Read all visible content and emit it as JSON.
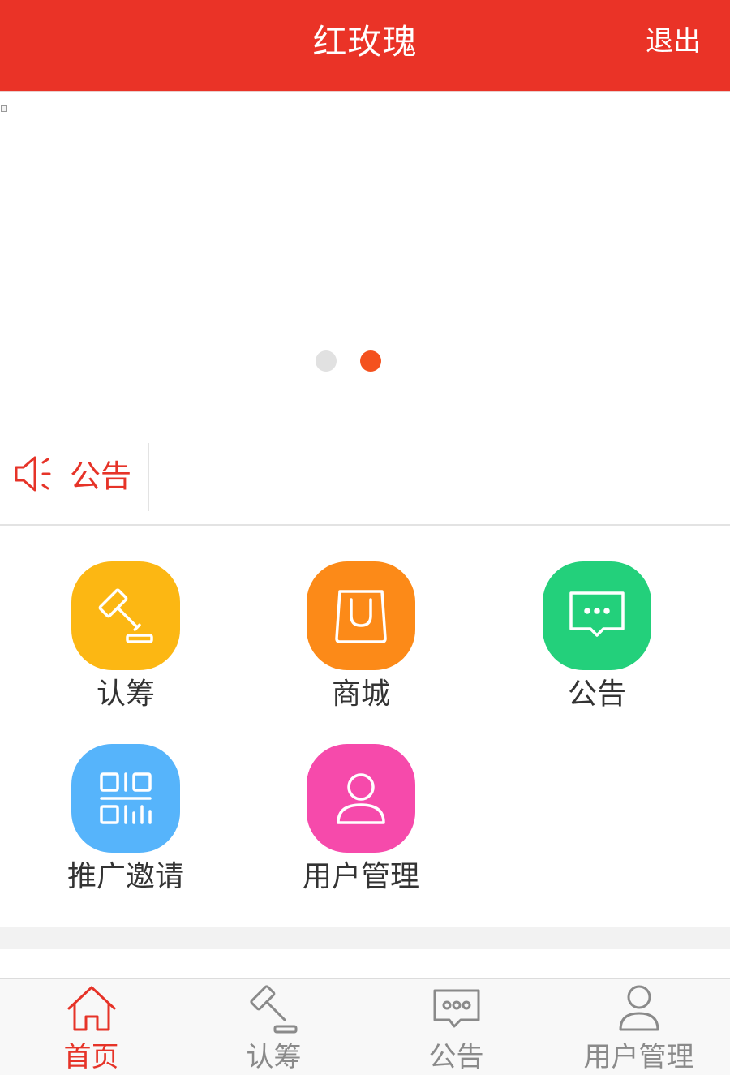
{
  "header": {
    "title": "红玫瑰",
    "logout_label": "退出"
  },
  "banner": {
    "active_slide": 2,
    "slide_count": 2
  },
  "notice": {
    "label": "公告",
    "icon": "speaker-icon"
  },
  "grid": {
    "items": [
      {
        "label": "认筹",
        "icon": "gavel-icon",
        "color": "#fcb713"
      },
      {
        "label": "商城",
        "icon": "shopping-bag-icon",
        "color": "#fc8a18"
      },
      {
        "label": "公告",
        "icon": "message-icon",
        "color": "#23d07b"
      },
      {
        "label": "推广邀请",
        "icon": "qr-code-icon",
        "color": "#56b4fb"
      },
      {
        "label": "用户管理",
        "icon": "user-icon",
        "color": "#f64aab"
      }
    ]
  },
  "tabbar": {
    "items": [
      {
        "label": "首页",
        "icon": "home-icon",
        "active": true
      },
      {
        "label": "认筹",
        "icon": "gavel-icon",
        "active": false
      },
      {
        "label": "公告",
        "icon": "message-icon",
        "active": false
      },
      {
        "label": "用户管理",
        "icon": "user-icon",
        "active": false
      }
    ]
  },
  "colors": {
    "brand": "#ea3327",
    "active": "#e63328",
    "inactive": "#8a8a8a"
  }
}
